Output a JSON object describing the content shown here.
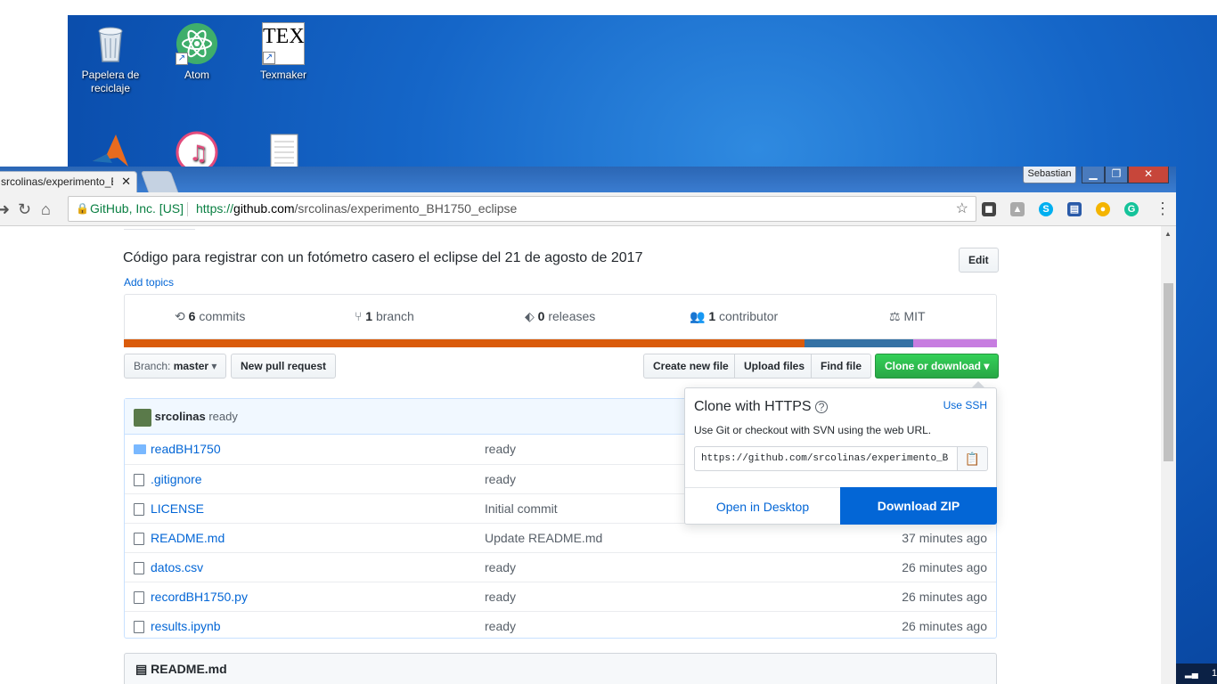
{
  "desktop": {
    "icons": [
      {
        "label": "Papelera de reciclaje",
        "icon": "recycle-bin-icon"
      },
      {
        "label": "Atom",
        "icon": "atom-icon"
      },
      {
        "label": "Texmaker",
        "icon": "texmaker-icon"
      },
      {
        "label": "",
        "icon": "matlab-icon"
      },
      {
        "label": "",
        "icon": "itunes-icon"
      },
      {
        "label": "",
        "icon": "text-file-icon"
      }
    ]
  },
  "browser": {
    "tab_title": "srcolinas/experimento_BH",
    "profile": "Sebastian",
    "security_label": "GitHub, Inc. [US]",
    "url": {
      "scheme": "https://",
      "domain": "github.com",
      "path": "/srcolinas/experimento_BH1750_eclipse"
    }
  },
  "repo": {
    "description": "Código para registrar con un fotómetro casero el eclipse del 21 de agosto de 2017",
    "edit_label": "Edit",
    "add_topics": "Add topics",
    "stats": {
      "commits_count": "6",
      "commits_label": "commits",
      "branch_count": "1",
      "branch_label": "branch",
      "releases_count": "0",
      "releases_label": "releases",
      "contributors_count": "1",
      "contributors_label": "contributor",
      "license": "MIT"
    },
    "languages": [
      {
        "share": 78.0,
        "color": "#da5b0b"
      },
      {
        "share": 12.4,
        "color": "#3572a5"
      },
      {
        "share": 9.6,
        "color": "#c77de0"
      }
    ],
    "branch_label": "Branch:",
    "branch_value": "master",
    "new_pr": "New pull request",
    "create_file": "Create new file",
    "upload_files": "Upload files",
    "find_file": "Find file",
    "clone_download": "Clone or download",
    "latest_commit": {
      "author": "srcolinas",
      "message": "ready"
    },
    "files": [
      {
        "name": "readBH1750",
        "type": "dir",
        "message": "ready",
        "age": ""
      },
      {
        "name": ".gitignore",
        "type": "file",
        "message": "ready",
        "age": ""
      },
      {
        "name": "LICENSE",
        "type": "file",
        "message": "Initial commit",
        "age": ""
      },
      {
        "name": "README.md",
        "type": "file",
        "message": "Update README.md",
        "age": "37 minutes ago"
      },
      {
        "name": "datos.csv",
        "type": "file",
        "message": "ready",
        "age": "26 minutes ago"
      },
      {
        "name": "recordBH1750.py",
        "type": "file",
        "message": "ready",
        "age": "26 minutes ago"
      },
      {
        "name": "results.ipynb",
        "type": "file",
        "message": "ready",
        "age": "26 minutes ago"
      }
    ],
    "readme_title": "README.md"
  },
  "clone_popover": {
    "title": "Clone with HTTPS",
    "use_ssh": "Use SSH",
    "description": "Use Git or checkout with SVN using the web URL.",
    "url": "https://github.com/srcolinas/experimento_B",
    "open_desktop": "Open in Desktop",
    "download_zip": "Download ZIP"
  },
  "taskbar": {
    "clock_fragment": "1"
  }
}
